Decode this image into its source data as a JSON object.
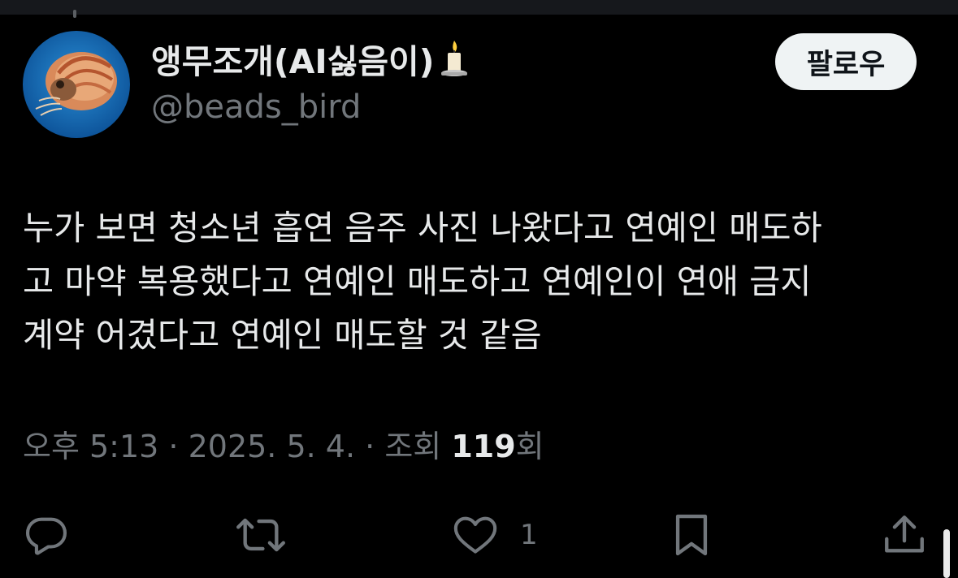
{
  "profile": {
    "display_name": "앵무조개(AI싫음이)",
    "display_name_emoji": "candle-icon",
    "handle": "@beads_bird",
    "avatar": "nautilus-avatar"
  },
  "follow_button": {
    "label": "팔로우"
  },
  "tweet": {
    "lines": [
      "누가 보면 청소년 흡연 음주 사진 나왔다고 연예인 매도하",
      "고 마약 복용했다고 연예인 매도하고 연예인이 연애 금지",
      "계약 어겼다고 연예인 매도할 것 같음"
    ]
  },
  "meta": {
    "time": "오후 5:13",
    "sep1": " · ",
    "date": "2025. 5. 4.",
    "sep2": " · ",
    "views_label": "조회 ",
    "views_count": "119",
    "views_suffix": "회"
  },
  "actions": {
    "reply_icon": "reply-icon",
    "retweet_icon": "retweet-icon",
    "like_icon": "heart-icon",
    "like_count": "1",
    "bookmark_icon": "bookmark-icon",
    "share_icon": "share-icon"
  },
  "colors": {
    "background": "#000000",
    "primary_text": "#e7e9ea",
    "secondary_text": "#71767b",
    "follow_button_bg": "#eff3f4",
    "follow_button_text": "#0f1419"
  }
}
